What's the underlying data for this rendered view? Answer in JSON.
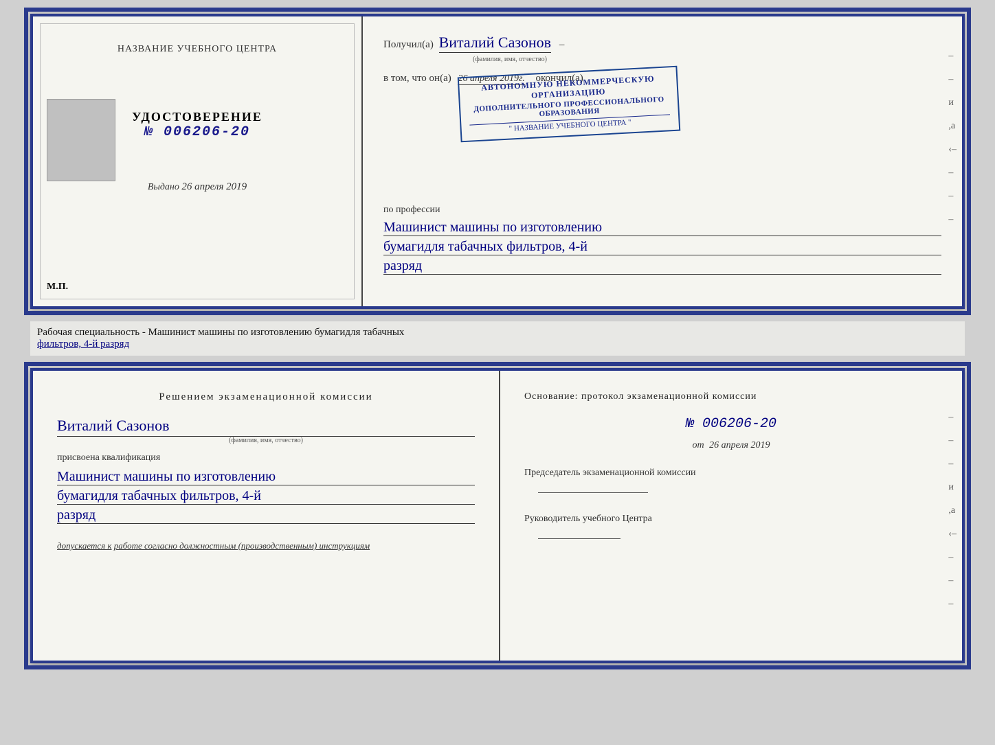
{
  "top_cert": {
    "left": {
      "center_title": "НАЗВАНИЕ УЧЕБНОГО ЦЕНТРА",
      "udostoverenie_label": "УДОСТОВЕРЕНИЕ",
      "cert_number": "№ 006206-20",
      "vydano_label": "Выдано",
      "vydano_date": "26 апреля 2019",
      "mp_label": "М.П."
    },
    "right": {
      "poluchil_label": "Получил(а)",
      "person_name": "Виталий Сазонов",
      "fio_subtitle": "(фамилия, имя, отчество)",
      "dash": "–",
      "vtom_label": "в том, что он(а)",
      "date_handwritten": "26 апреля 2019г.",
      "okonchil_label": "окончил(а)",
      "stamp_line1": "АВТОНОМНУЮ НЕКОММЕРЧЕСКУЮ ОРГАНИЗАЦИЮ",
      "stamp_line2": "ДОПОЛНИТЕЛЬНОГО ПРОФЕССИОНАЛЬНОГО ОБРАЗОВАНИЯ",
      "stamp_name": "\" НАЗВАНИЕ УЧЕБНОГО ЦЕНТРА \"",
      "po_professii_label": "по профессии",
      "profession_line1": "Машинист машины по изготовлению",
      "profession_line2": "бумагидля табачных фильтров, 4-й",
      "profession_line3": "разряд"
    }
  },
  "middle": {
    "text_normal": "Рабочая специальность - Машинист машины по изготовлению бумагидля табачных",
    "text_underline": "фильтров, 4-й разряд"
  },
  "bottom_cert": {
    "left": {
      "decision_title": "Решением  экзаменационной  комиссии",
      "person_name": "Виталий Сазонов",
      "fio_label": "(фамилия, имя, отчество)",
      "prisvoena_label": "присвоена квалификация",
      "qual_line1": "Машинист машины по изготовлению",
      "qual_line2": "бумагидля табачных фильтров, 4-й",
      "qual_line3": "разряд",
      "dopuskaetsya_label": "допускается к",
      "dopuskaetsya_text": "работе согласно должностным (производственным) инструкциям"
    },
    "right": {
      "osnovanie_label": "Основание: протокол экзаменационной  комиссии",
      "protocol_number": "№  006206-20",
      "ot_label": "от",
      "ot_date": "26 апреля 2019",
      "predsedatel_label": "Председатель экзаменационной комиссии",
      "rukovoditel_label": "Руководитель учебного Центра"
    }
  },
  "side_dashes_top": [
    "–",
    "–",
    "–",
    "и",
    ",а",
    "‹–",
    "–",
    "–",
    "–"
  ],
  "side_dashes_bottom": [
    "–",
    "–",
    "–",
    "и",
    ",а",
    "‹–",
    "–",
    "–",
    "–"
  ]
}
